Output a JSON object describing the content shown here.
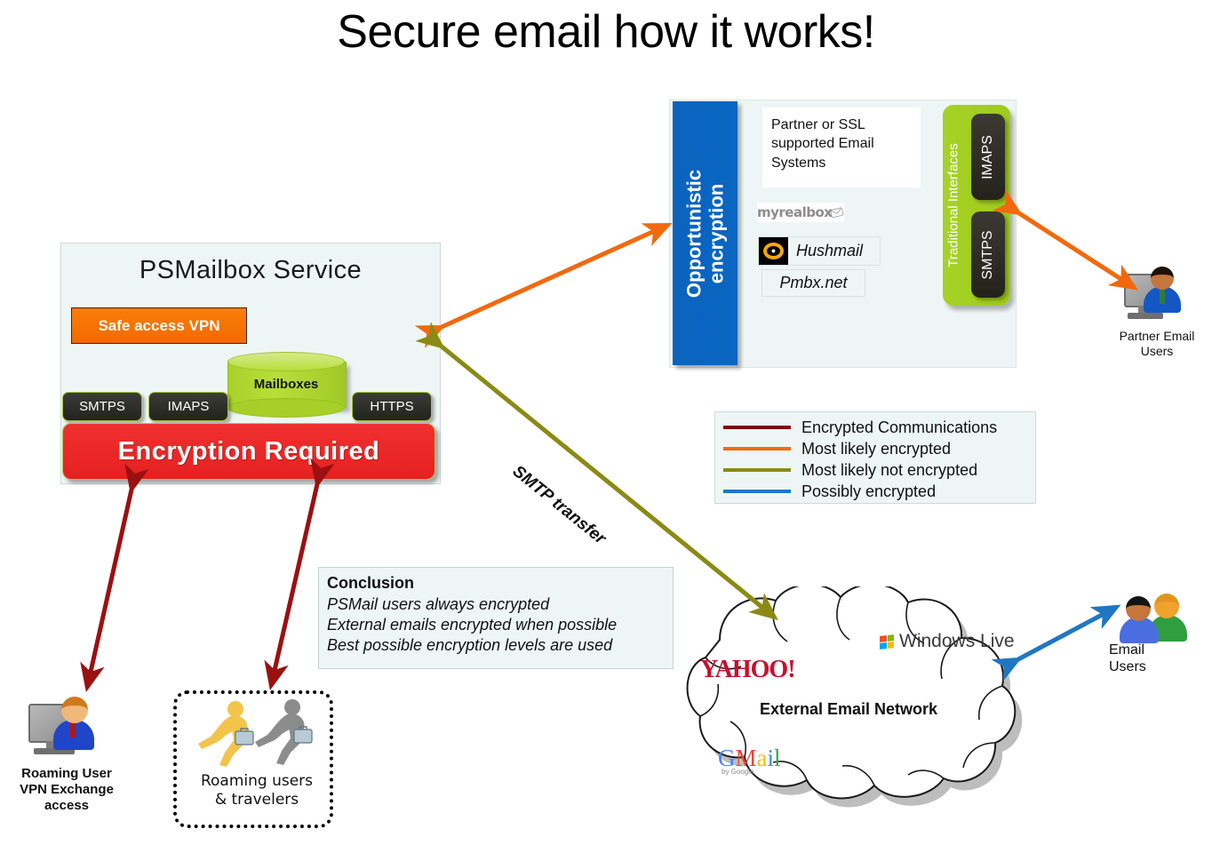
{
  "title": "Secure email how it works!",
  "psmailbox": {
    "title": "PSMailbox  Service",
    "safe_vpn": "Safe access VPN",
    "mailboxes": "Mailboxes",
    "ports": [
      "SMTPS",
      "IMAPS",
      "HTTPS"
    ],
    "encryption_required": "Encryption  Required"
  },
  "opportunistic": {
    "bar_label_line1": "Opportunistic",
    "bar_label_line2": "encryption",
    "partner_ssl": "Partner or SSL supported Email Systems",
    "myrealbox": "myrealbox",
    "hushmail": "Hushmail",
    "pmbx": "Pmbx.net",
    "traditional_interfaces": "Traditional Interfaces",
    "vports": [
      "IMAPS",
      "SMTPS"
    ]
  },
  "legend": {
    "items": [
      {
        "label": "Encrypted Communications",
        "color": "#7b0a0a"
      },
      {
        "label": "Most likely encrypted",
        "color": "#f2690d"
      },
      {
        "label": "Most likely not encrypted",
        "color": "#8a8a14"
      },
      {
        "label": "Possibly encrypted",
        "color": "#1f77c4"
      }
    ]
  },
  "conclusion": {
    "heading": "Conclusion",
    "lines": [
      "PSMail users always encrypted",
      "External emails encrypted when possible",
      "Best possible encryption levels are used"
    ]
  },
  "cloud": {
    "title": "External Email Network",
    "logos": {
      "yahoo": "YAHOO!",
      "windows_live_brand": "Windows",
      "windows_live_sub": "Live",
      "gmail": "Gmail",
      "gmail_by": "by Google"
    }
  },
  "arrows": {
    "smtp_transfer": "SMTP transfer"
  },
  "actors": {
    "roaming_user": "Roaming User\nVPN Exchange\naccess",
    "roaming_user_l1": "Roaming User",
    "roaming_user_l2": "VPN Exchange",
    "roaming_user_l3": "access",
    "travelers_l1": "Roaming users",
    "travelers_l2": "& travelers",
    "partner_email_l1": "Partner Email",
    "partner_email_l2": "Users",
    "email_users_l1": "Email",
    "email_users_l2": "Users"
  },
  "colors": {
    "dark_red": "#7b0a0a",
    "orange": "#f2690d",
    "olive": "#8a8a14",
    "blue": "#1f77c4",
    "panel_bg": "#eef6f5",
    "green": "#a3d220",
    "red": "#ee2020",
    "brand_blue": "#0a66c2"
  }
}
